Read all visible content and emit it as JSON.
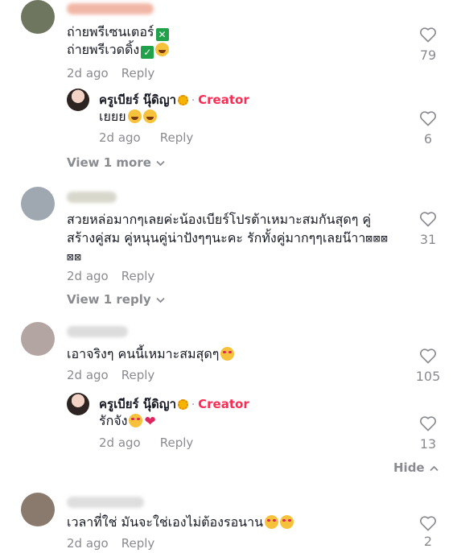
{
  "comments": [
    {
      "name_blurred": "",
      "text_line1": "ถ่ายพรีเซนเตอร์",
      "text_line2": "ถ่ายพรีเวดดิ้ง",
      "time": "2d ago",
      "reply_label": "Reply",
      "likes": "79",
      "replies": [
        {
          "author": "ครูเบียร์ นุ๊ดิญา",
          "badge": "Creator",
          "text": "เยยย",
          "time": "2d ago",
          "reply_label": "Reply",
          "likes": "6"
        }
      ],
      "view_more": "View 1 more"
    },
    {
      "text": "สวยหล่อมากๆเลยค่ะน้องเบียร์โปรต้าเหมาะสมกันสุดๆ คู่สร้างคู่สม คู่หนุนคู่น่าปังๆๆนะคะ รักทั้งคู่มากๆๆเลยน๊าาา",
      "text_line1": "สวยหล่อมากๆเลยค่ะน้องเบียร์โปรต้าเหมาะสมกันสุดๆ คู่",
      "text_line2": "สร้างคู่สม คู่หนุนคู่น่าปังๆๆนะคะ รักทั้งคู่มากๆๆเลยน๊าา",
      "glyphs_a": "⊠⊠⊠",
      "glyphs_b": "⊠⊠",
      "time": "2d ago",
      "reply_label": "Reply",
      "likes": "31",
      "view_more": "View 1 reply"
    },
    {
      "text": "เอาจริงๆ คนนี้เหมาะสมสุดๆ",
      "time": "2d ago",
      "reply_label": "Reply",
      "likes": "105",
      "replies": [
        {
          "author": "ครูเบียร์ นุ๊ดิญา",
          "badge": "Creator",
          "text": "รักจัง",
          "time": "2d ago",
          "reply_label": "Reply",
          "likes": "13"
        }
      ],
      "hide_label": "Hide"
    },
    {
      "text": "เวลาที่ใช่ มันจะใช่เองไม่ต้องรอนาน",
      "time": "2d ago",
      "reply_label": "Reply",
      "likes": "2"
    }
  ],
  "colors": {
    "creator_badge": "#fe2c55",
    "muted": "#8a8b91",
    "text": "#161823"
  },
  "icons": [
    "heart-outline-icon",
    "chevron-down-icon",
    "chevron-up-icon"
  ]
}
